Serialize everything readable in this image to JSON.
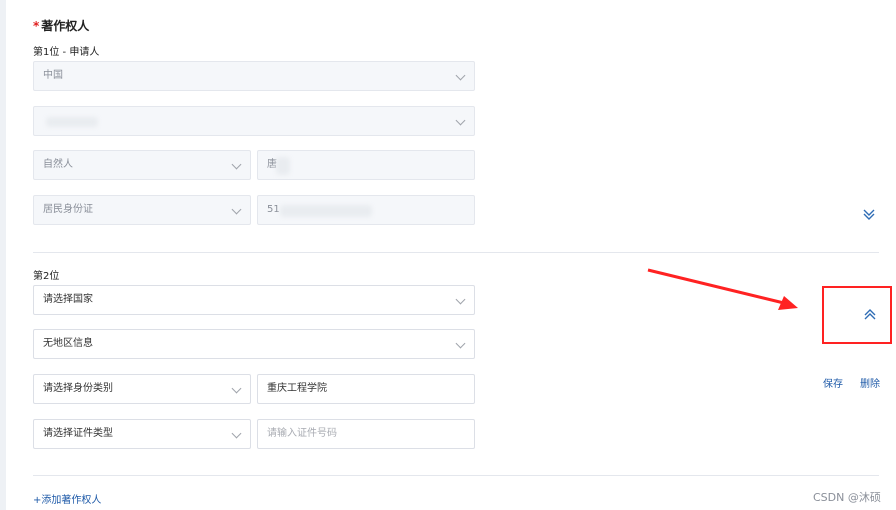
{
  "section": {
    "required_mark": "*",
    "title": "著作权人"
  },
  "author1": {
    "heading": "第1位 - 申请人",
    "country": "中国",
    "region": "",
    "identity_type": "自然人",
    "name": "唐",
    "id_type": "居民身份证",
    "id_number": "51"
  },
  "author2": {
    "heading": "第2位",
    "country_placeholder": "请选择国家",
    "region_value": "无地区信息",
    "identity_placeholder": "请选择身份类别",
    "name_value": "重庆工程学院",
    "id_type_placeholder": "请选择证件类型",
    "id_number_placeholder": "请输入证件号码",
    "save_label": "保存",
    "delete_label": "删除"
  },
  "add_author_label": "+添加著作权人",
  "watermark": "CSDN @沐硕",
  "colors": {
    "link": "#1e5aa8",
    "annotation": "#ff2222",
    "required": "#e02020"
  },
  "icons": {
    "expand": "double-chevron-down-icon",
    "collapse": "double-chevron-up-icon"
  }
}
